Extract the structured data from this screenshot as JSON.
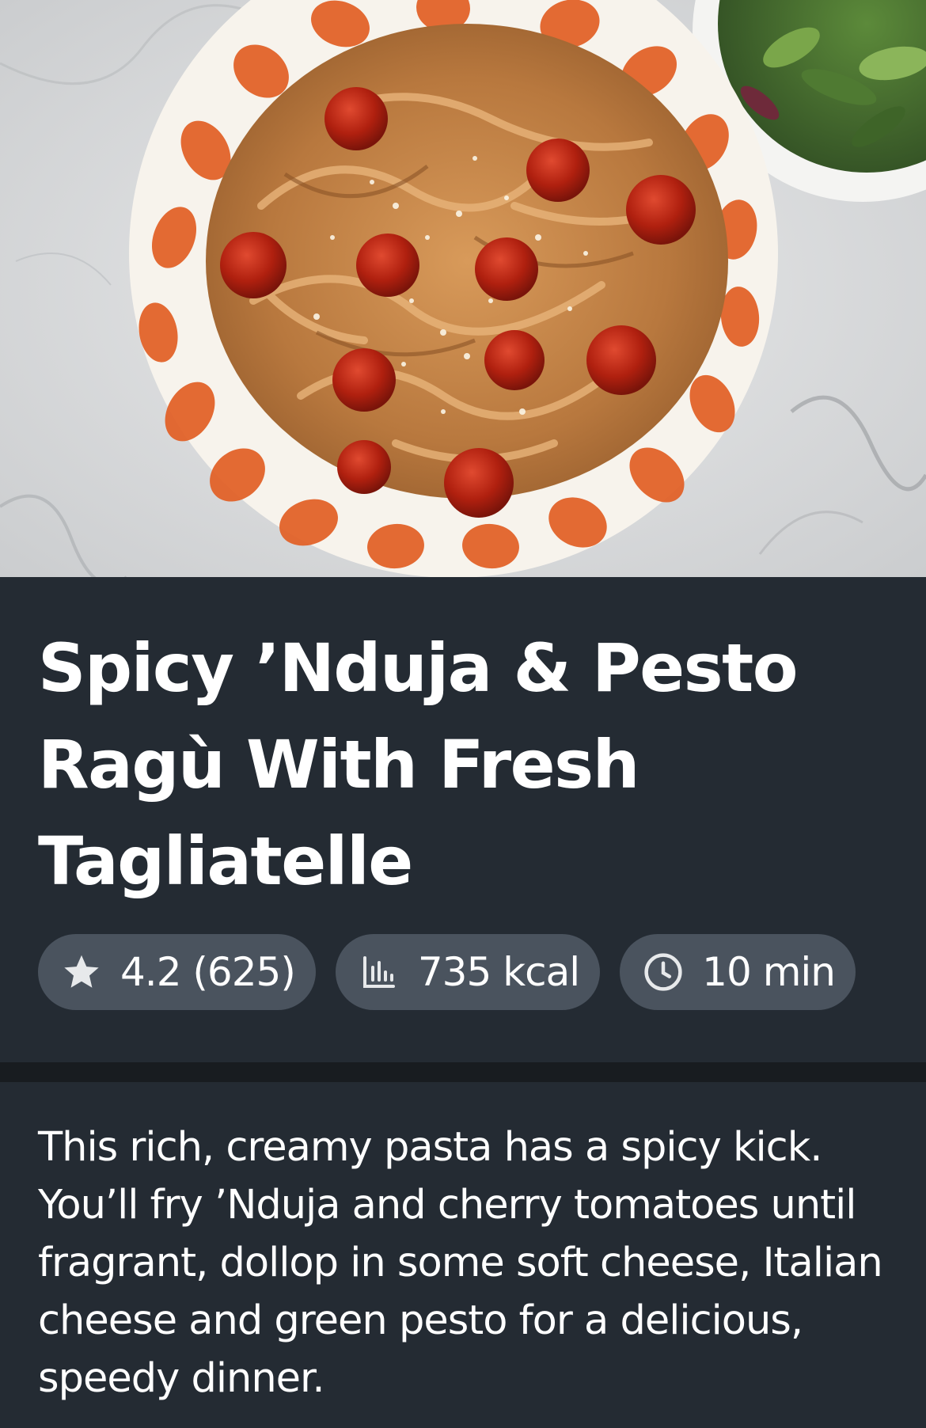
{
  "hero": {
    "image": "tagliatelle-pasta-plate-photo"
  },
  "recipe": {
    "title": "Spicy ’Nduja & Pesto Ragù With Fresh Tagliatelle",
    "stats": {
      "rating": "4.2 (625)",
      "calories": "735 kcal",
      "time": "10 min"
    },
    "description": "This rich, creamy pasta has a spicy kick. You’ll fry ’Nduja and cherry tomatoes until fragrant, dollop in some soft cheese, Italian cheese and green pesto for a delicious, speedy dinner."
  },
  "icons": {
    "rating": "star-icon",
    "calories": "bar-chart-icon",
    "time": "clock-icon"
  },
  "colors": {
    "background": "#242b33",
    "chip": "#4a535e",
    "divider": "#181c20",
    "text": "#ffffff"
  }
}
